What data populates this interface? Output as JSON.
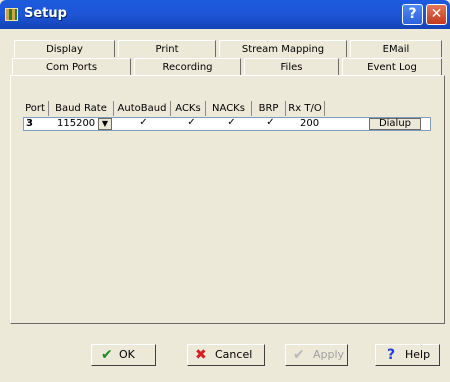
{
  "window": {
    "title": "Setup"
  },
  "titlebar": {
    "help_label": "?",
    "close_label": "✕"
  },
  "tabs": {
    "row1": [
      "Display",
      "Print",
      "Stream Mapping",
      "EMail"
    ],
    "row2": [
      "Com Ports",
      "Recording",
      "Files",
      "Event Log"
    ],
    "selected": "Com Ports"
  },
  "table": {
    "headers": [
      "Port",
      "Baud Rate",
      "AutoBaud",
      "ACKs",
      "NACKs",
      "BRP",
      "Rx T/O"
    ],
    "row": {
      "port": "3",
      "baud_rate": "115200",
      "autobaud": true,
      "acks": true,
      "nacks": true,
      "brp": true,
      "rx_to": "200",
      "dialup_label": "Dialup"
    }
  },
  "buttons": {
    "ok": "OK",
    "cancel": "Cancel",
    "apply": "Apply",
    "help": "Help"
  },
  "colors": {
    "titlebar": "#1e55d6",
    "face": "#ece9d8",
    "ok_check": "#1f8a1f",
    "cancel_x": "#d32020",
    "help_q": "#1f3fd6"
  }
}
